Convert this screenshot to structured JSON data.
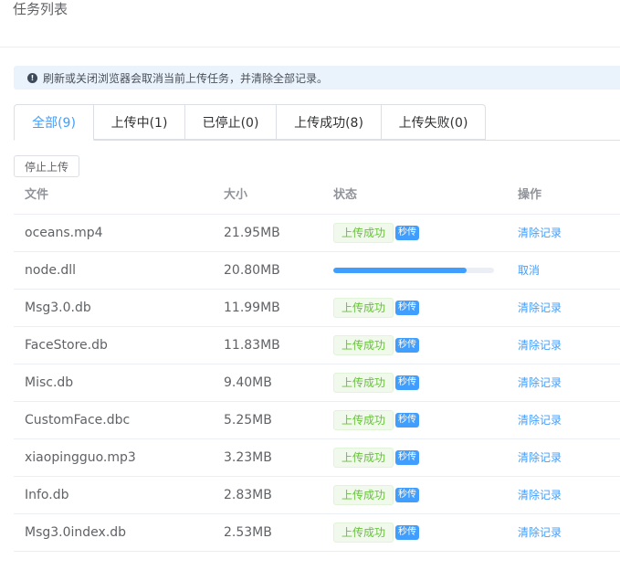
{
  "page": {
    "title": "任务列表"
  },
  "alert": {
    "icon": "info-circle-icon",
    "message": "刷新或关闭浏览器会取消当前上传任务，并清除全部记录。"
  },
  "tabs": [
    {
      "label": "全部(9)",
      "active": true
    },
    {
      "label": "上传中(1)",
      "active": false
    },
    {
      "label": "已停止(0)",
      "active": false
    },
    {
      "label": "上传成功(8)",
      "active": false
    },
    {
      "label": "上传失败(0)",
      "active": false
    }
  ],
  "toolbar": {
    "stop_label": "停止上传"
  },
  "table": {
    "headers": {
      "file": "文件",
      "size": "大小",
      "status": "状态",
      "op": "操作"
    },
    "rows": [
      {
        "file": "oceans.mp4",
        "size": "21.95MB",
        "status": "上传成功",
        "badge": "秒传",
        "action": "清除记录"
      },
      {
        "file": "node.dll",
        "size": "20.80MB",
        "progress": 0.83,
        "action": "取消"
      },
      {
        "file": "Msg3.0.db",
        "size": "11.99MB",
        "status": "上传成功",
        "badge": "秒传",
        "action": "清除记录"
      },
      {
        "file": "FaceStore.db",
        "size": "11.83MB",
        "status": "上传成功",
        "badge": "秒传",
        "action": "清除记录"
      },
      {
        "file": "Misc.db",
        "size": "9.40MB",
        "status": "上传成功",
        "badge": "秒传",
        "action": "清除记录"
      },
      {
        "file": "CustomFace.dbc",
        "size": "5.25MB",
        "status": "上传成功",
        "badge": "秒传",
        "action": "清除记录"
      },
      {
        "file": "xiaopingguo.mp3",
        "size": "3.23MB",
        "status": "上传成功",
        "badge": "秒传",
        "action": "清除记录"
      },
      {
        "file": "Info.db",
        "size": "2.83MB",
        "status": "上传成功",
        "badge": "秒传",
        "action": "清除记录"
      },
      {
        "file": "Msg3.0index.db",
        "size": "2.53MB",
        "status": "上传成功",
        "badge": "秒传",
        "action": "清除记录"
      }
    ]
  },
  "colors": {
    "primary": "#409eff",
    "success": "#67c23a",
    "success_bg": "#f0f9eb",
    "info_bg": "#eaf3fc"
  }
}
